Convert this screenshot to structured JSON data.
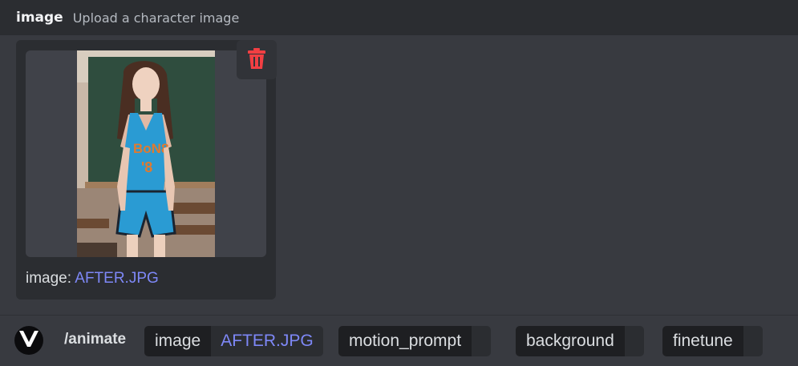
{
  "option_header": {
    "name": "image",
    "description": "Upload a character image"
  },
  "upload": {
    "label": "image:",
    "filename": "AFTER.JPG",
    "preview_subject": "character-photo",
    "delete_icon": "trash-icon",
    "delete_color": "#f23f43"
  },
  "command": {
    "bot_icon": "v-logo-icon",
    "name": "/animate",
    "options": [
      {
        "key": "image",
        "value": "AFTER.JPG"
      },
      {
        "key": "motion_prompt",
        "value": ""
      },
      {
        "key": "background",
        "value": ""
      },
      {
        "key": "finetune",
        "value": ""
      }
    ]
  },
  "colors": {
    "accent_link": "#7e88f7",
    "background": "#383a40",
    "panel": "#2b2d31"
  }
}
